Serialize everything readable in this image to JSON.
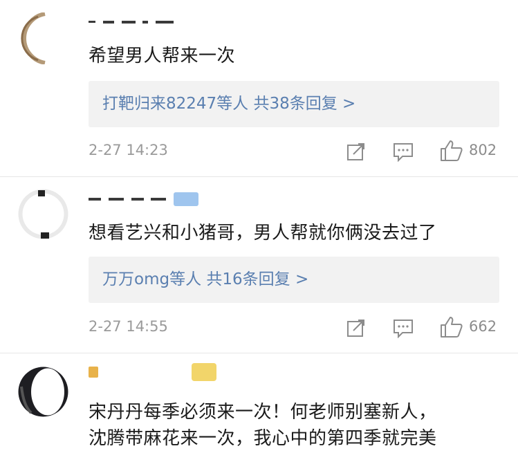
{
  "comments": [
    {
      "text": "希望男人帮来一次",
      "replies": "打靶归来82247等人  共38条回复 >",
      "time": "2-27 14:23",
      "likes": "802"
    },
    {
      "text": "想看艺兴和小猪哥，男人帮就你俩没去过了",
      "replies": "万万omg等人  共16条回复 >",
      "time": "2-27 14:55",
      "likes": "662"
    },
    {
      "text_line1": "宋丹丹每季必须来一次！何老师别塞新人，",
      "text_line2": "沈腾带麻花来一次，我心中的第四季就完美"
    }
  ],
  "icons": [
    "share-icon",
    "comment-icon",
    "like-icon"
  ],
  "colors": {
    "link": "#5a7fb0",
    "meta": "#9a9a9a",
    "reply_bg": "#f2f2f2"
  }
}
